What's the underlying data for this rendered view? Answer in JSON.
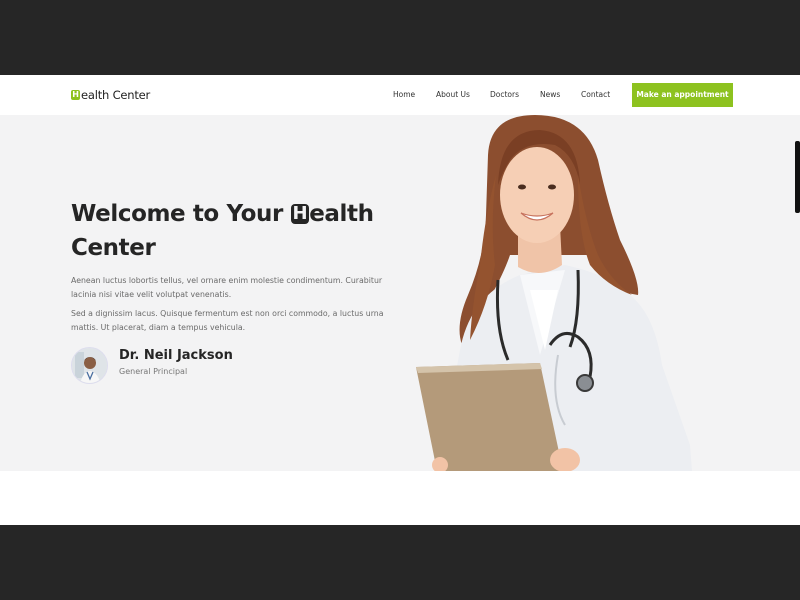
{
  "header": {
    "logo_letter": "H",
    "logo_rest": "ealth Center",
    "nav": [
      "Home",
      "About Us",
      "Doctors",
      "News",
      "Contact"
    ],
    "cta_label": "Make an appointment"
  },
  "hero": {
    "title_part1": "Welcome to Your ",
    "title_letter": "H",
    "title_part2": "ealth Center",
    "para1": "Aenean luctus lobortis tellus, vel ornare enim molestie condimentum. Curabitur lacinia nisi vitae velit volutpat venenatis.",
    "para2": "Sed a dignissim lacus. Quisque fermentum est non orci commodo, a luctus urna mattis. Ut placerat, diam a tempus vehicula.",
    "doctor_name": "Dr. Neil Jackson",
    "doctor_role": "General Principal"
  },
  "colors": {
    "accent": "#8dc21f",
    "hero_bg": "#f3f3f4",
    "frame_bg": "#262626"
  },
  "icons": {
    "logo": "h-badge-icon",
    "avatar": "doctor-avatar-image",
    "hero_image": "doctor-with-tablet-image"
  }
}
